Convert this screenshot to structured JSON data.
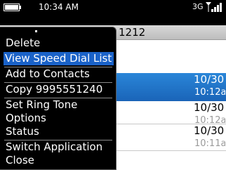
{
  "status_bar": {
    "time": "10:34 AM",
    "network": "3G",
    "icons": [
      "battery-icon",
      "signal-strength-icon"
    ]
  },
  "title": {
    "number_fragment": "1212"
  },
  "call_log": {
    "entries": [
      {
        "date": "10/30",
        "time": "10:12a",
        "selected": true
      },
      {
        "date": "10/30",
        "time": "10:12a",
        "selected": false
      },
      {
        "date": "10/30",
        "time": "10:11a",
        "selected": false
      }
    ]
  },
  "menu": {
    "items": [
      {
        "label": "Delete"
      },
      {
        "label": "View Speed Dial List",
        "selected": true
      },
      {
        "label": "Add to Contacts"
      },
      {
        "label": "Copy 9995551240"
      },
      {
        "label": "Set Ring Tone"
      },
      {
        "label": "Options"
      },
      {
        "label": "Status"
      },
      {
        "label": "Switch Application"
      },
      {
        "label": "Close"
      }
    ]
  },
  "colors": {
    "selection": "#1a62c8",
    "list_selection": "#2a86d8",
    "menu_background": "#000000"
  }
}
